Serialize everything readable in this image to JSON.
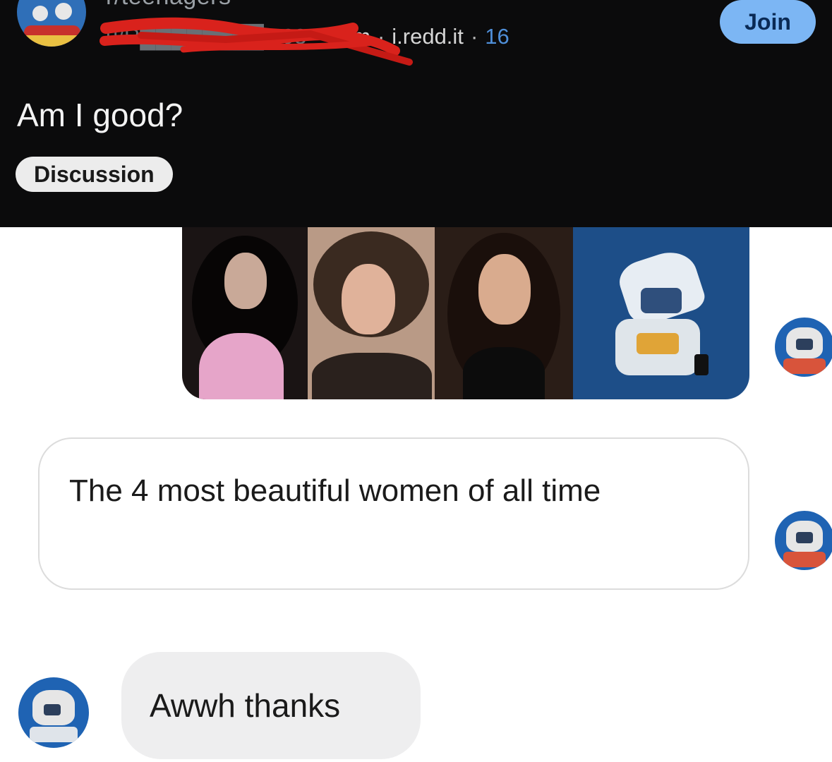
{
  "post": {
    "community": "r/teenagers",
    "author": "u/R████████t593",
    "time": "10m",
    "domain": "i.redd.it",
    "count": "16",
    "join_label": "Join",
    "title": "Am I good?",
    "flair": "Discussion"
  },
  "chat": {
    "sent_message": "The 4 most beautiful women of all time",
    "received_message": "Awwh thanks"
  },
  "colors": {
    "header_bg": "#0b0b0c",
    "join_bg": "#7cb6f4",
    "count_blue": "#4f8fd9",
    "redaction_red": "#d9221c",
    "received_bubble": "#eeeeef"
  }
}
